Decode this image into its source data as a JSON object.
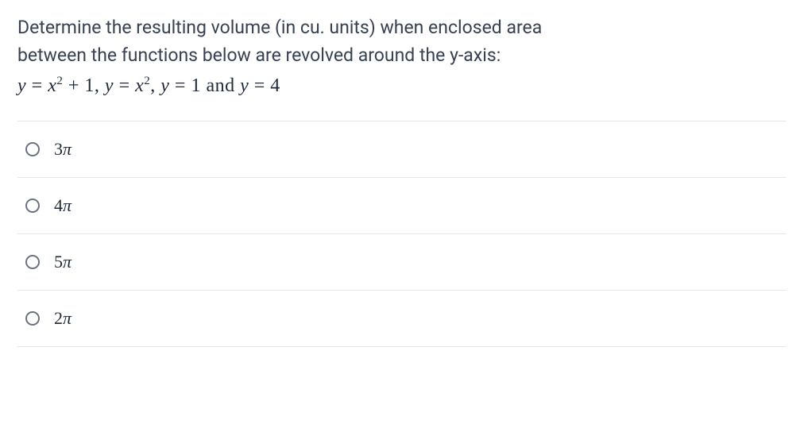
{
  "question": {
    "line1": "Determine the resulting volume (in cu. units) when enclosed area",
    "line2": "between the functions below are revolved around the y-axis:"
  },
  "options": [
    {
      "num": "3",
      "sym": "π"
    },
    {
      "num": "4",
      "sym": "π"
    },
    {
      "num": "5",
      "sym": "π"
    },
    {
      "num": "2",
      "sym": "π"
    }
  ]
}
